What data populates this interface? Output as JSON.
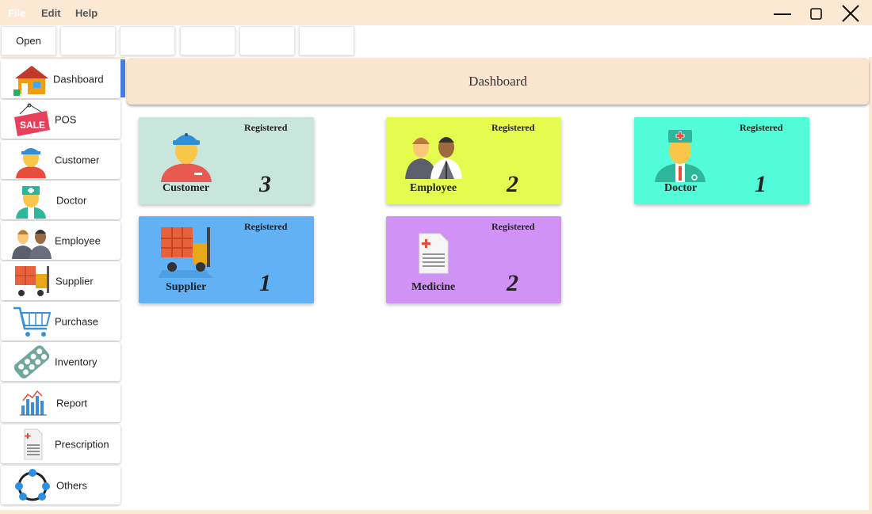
{
  "menu": {
    "file": "File",
    "edit": "Edit",
    "help": "Help"
  },
  "toolbar": {
    "buttons": [
      "Open",
      "",
      "",
      "",
      "",
      ""
    ]
  },
  "sidebar": {
    "items": [
      {
        "label": "Dashboard",
        "icon": "house-icon",
        "active": true
      },
      {
        "label": "POS",
        "icon": "sale-tag-icon"
      },
      {
        "label": "Customer",
        "icon": "customer-icon"
      },
      {
        "label": "Doctor",
        "icon": "doctor-icon"
      },
      {
        "label": "Employee",
        "icon": "employee-icon"
      },
      {
        "label": "Supplier",
        "icon": "forklift-icon"
      },
      {
        "label": "Purchase",
        "icon": "cart-icon"
      },
      {
        "label": "Inventory",
        "icon": "pills-icon"
      },
      {
        "label": "Report",
        "icon": "bar-chart-icon"
      },
      {
        "label": "Prescription",
        "icon": "prescription-icon"
      },
      {
        "label": "Others",
        "icon": "network-icon"
      }
    ]
  },
  "header": {
    "title": "Dashboard"
  },
  "cards": [
    {
      "name": "Customer",
      "registered": "Registered",
      "count": "3",
      "color": "#c9e6dc"
    },
    {
      "name": "Employee",
      "registered": "Registered",
      "count": "2",
      "color": "#e5fc4f"
    },
    {
      "name": "Doctor",
      "registered": "Registered",
      "count": "1",
      "color": "#52fcd8"
    },
    {
      "name": "Supplier",
      "registered": "Registered",
      "count": "1",
      "color": "#62b1f4"
    },
    {
      "name": "Medicine",
      "registered": "Registered",
      "count": "2",
      "color": "#d192f6"
    }
  ],
  "colors": {
    "accent": "#4a7be0",
    "background": "#fbe9d4"
  }
}
